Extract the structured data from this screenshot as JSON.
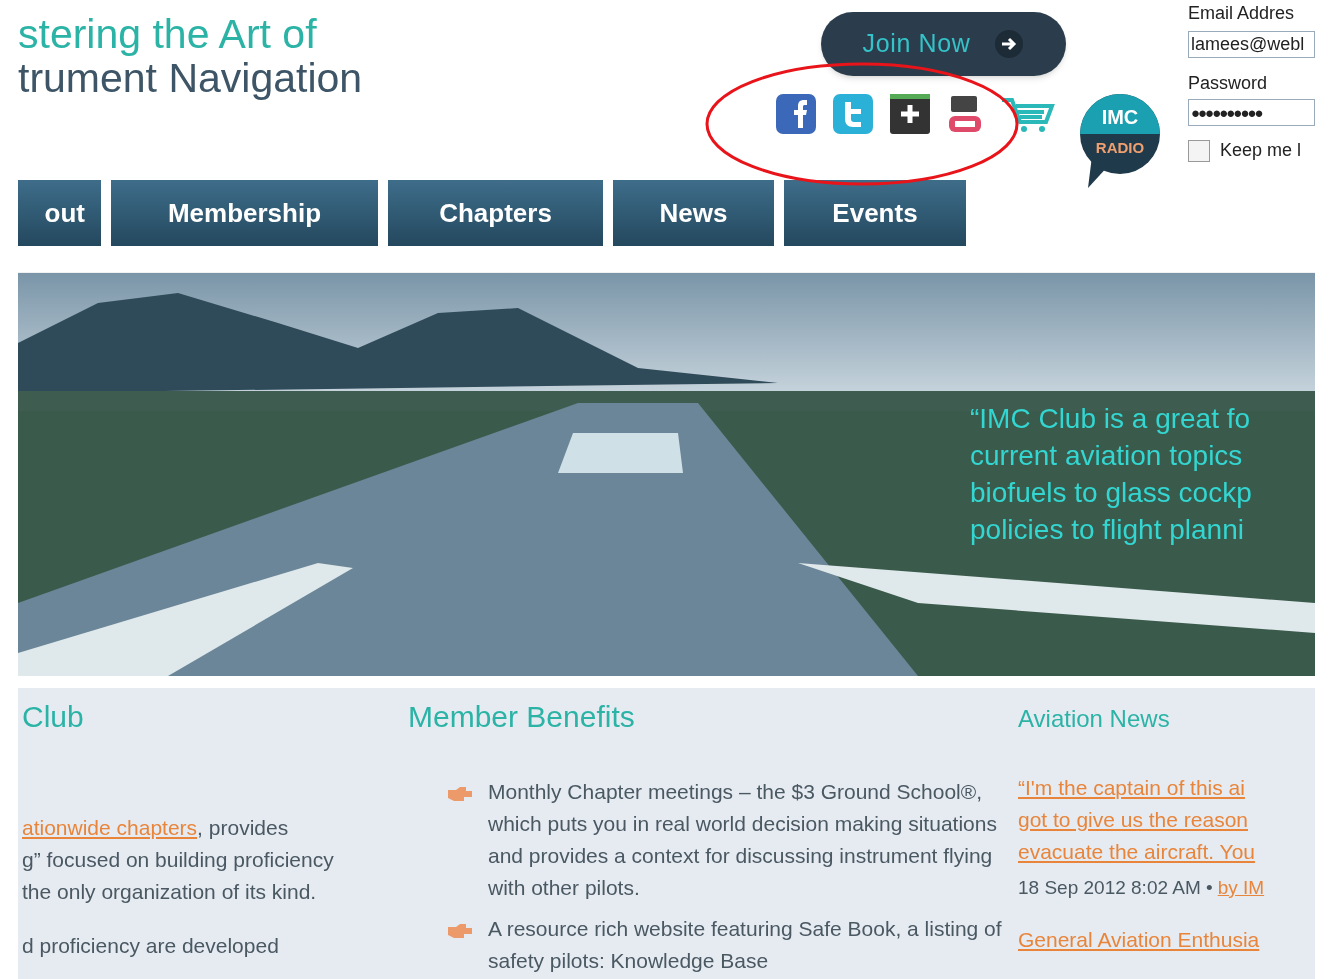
{
  "site_title": {
    "line_1": "stering the Art of",
    "line_2": "trument Navigation"
  },
  "join_button": {
    "label": "Join Now"
  },
  "radio_badge": {
    "line_1": "IMC",
    "line_2": "RADIO"
  },
  "login": {
    "email_label": "Email Addres",
    "email_value": "lamees@webl",
    "password_label": "Password",
    "password_value": "●●●●●●●●●●",
    "remember_label": "Keep me l",
    "remember_checked": false
  },
  "nav": [
    {
      "label": "out"
    },
    {
      "label": "Membership"
    },
    {
      "label": "Chapters"
    },
    {
      "label": "News"
    },
    {
      "label": "Events"
    }
  ],
  "hero": {
    "quote": "“IMC Club is a great fo\ncurrent aviation topics\nbiofuels to glass cockp\npolicies to flight planni"
  },
  "club": {
    "heading": "Club",
    "paragraphs": [
      {
        "link": "ationwide chapters",
        "text": ", provides\ng” focused on building proficiency\nthe only organization of its kind."
      },
      {
        "text": "d proficiency are developed"
      }
    ]
  },
  "benefits": {
    "heading": "Member Benefits",
    "items": [
      "Monthly Chapter meetings – the $3 Ground School®, which puts you in real world decision making situations and provides a context for discussing instrument flying with other pilots.",
      "A resource rich website featuring Safe Book, a listing of safety pilots: Knowledge Base"
    ]
  },
  "news": {
    "heading": "Aviation News",
    "items": [
      {
        "title": "“I'm the captain of this ai\ngot to give us the reason\nevacuate the aircraft. You",
        "date": "18 Sep 2012 8:02 AM •",
        "author": "by IM"
      },
      {
        "title": "General Aviation Enthusia"
      }
    ]
  }
}
